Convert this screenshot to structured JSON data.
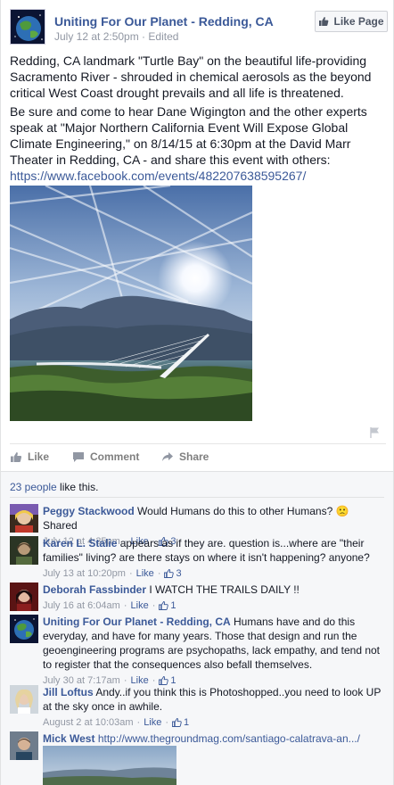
{
  "post": {
    "page_name": "Uniting For Our Planet - Redding, CA",
    "meta": "July 12 at 2:50pm · Edited",
    "like_page_label": "Like Page",
    "paragraph1": "Redding, CA landmark \"Turtle Bay\" on the beautiful life-providing Sacramento River - shrouded in chemical aerosols as the beyond critical West Coast drought prevails and all life is threatened.",
    "paragraph2": "Be sure and come to hear Dane Wigington and the other experts speak at \"Major Northern California Event Will Expose Global Climate Engineering,\" on 8/14/15 at 6:30pm at the David Marr Theater in Redding, CA - and share this event with others:",
    "event_link": "https://www.facebook.com/events/482207638595267/"
  },
  "actions": {
    "like": "Like",
    "comment": "Comment",
    "share": "Share"
  },
  "likes": {
    "people_link": "23 people",
    "suffix": " like this."
  },
  "comments": [
    {
      "author": "Peggy Stackwood",
      "text": "Would Humans do this to other Humans? 🙁 Shared",
      "time": "July 12 at 4:35pm",
      "like": "Like",
      "count": "3"
    },
    {
      "author": "Karen L. Stalie",
      "text": "appears as if they are. question is...where are \"their families\" living? are there stays on where it isn't happening? anyone?",
      "time": "July 13 at 10:20pm",
      "like": "Like",
      "count": "3"
    },
    {
      "author": "Deborah Fassbinder",
      "text": "I WATCH THE TRAILS DAILY !!",
      "time": "July 16 at 6:04am",
      "like": "Like",
      "count": "1"
    },
    {
      "author": "Uniting For Our Planet - Redding, CA",
      "text": "Humans have and do this everyday, and have for many years. Those that design and run the geoengineering programs are psychopaths, lack empathy, and tend not to register that the consequences also befall themselves.",
      "time": "July 30 at 7:17am",
      "like": "Like",
      "count": "1"
    },
    {
      "author": "Jill Loftus",
      "text": "Andy..if you think this is Photoshopped..you need to look UP at the sky once in awhile.",
      "time": "August 2 at 10:03am",
      "like": "Like",
      "count": "1"
    },
    {
      "author": "Mick West",
      "text": "http://www.thegroundmag.com/santiago-calatrava-an.../"
    }
  ],
  "colors": {
    "link": "#3b5998",
    "meta": "#9197a3",
    "ufi_bg": "#f6f7f9"
  },
  "icons": [
    "globe-avatar-icon",
    "thumbs-up-icon",
    "comment-bubble-icon",
    "share-arrow-icon",
    "flag-icon"
  ]
}
